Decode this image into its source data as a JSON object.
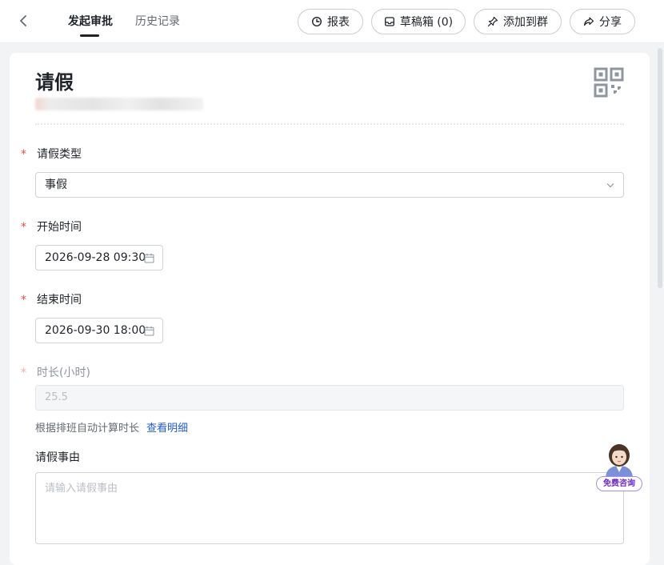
{
  "header": {
    "tabs": [
      {
        "label": "发起审批",
        "active": true
      },
      {
        "label": "历史记录",
        "active": false
      }
    ],
    "actions": [
      {
        "label": "报表",
        "icon": "pie-chart-icon"
      },
      {
        "label": "草稿箱 (0)",
        "icon": "inbox-icon"
      },
      {
        "label": "添加到群",
        "icon": "pin-icon"
      },
      {
        "label": "分享",
        "icon": "share-icon"
      }
    ]
  },
  "form": {
    "title": "请假",
    "fields": {
      "leave_type": {
        "label": "请假类型",
        "value": "事假",
        "required": true
      },
      "start_time": {
        "label": "开始时间",
        "value": "2026-09-28 09:30",
        "required": true
      },
      "end_time": {
        "label": "结束时间",
        "value": "2026-09-30 18:00",
        "required": true
      },
      "duration": {
        "label": "时长(小时)",
        "value": "25.5",
        "required": true,
        "readonly": true
      },
      "reason": {
        "label": "请假事由",
        "placeholder": "请输入请假事由"
      }
    },
    "duration_hint": "根据排班自动计算时长",
    "duration_link": "查看明细",
    "required_mark": "*"
  },
  "assistant": {
    "badge": "免费咨询"
  },
  "colors": {
    "accent_link": "#245bdb",
    "required": "#f54a45"
  }
}
